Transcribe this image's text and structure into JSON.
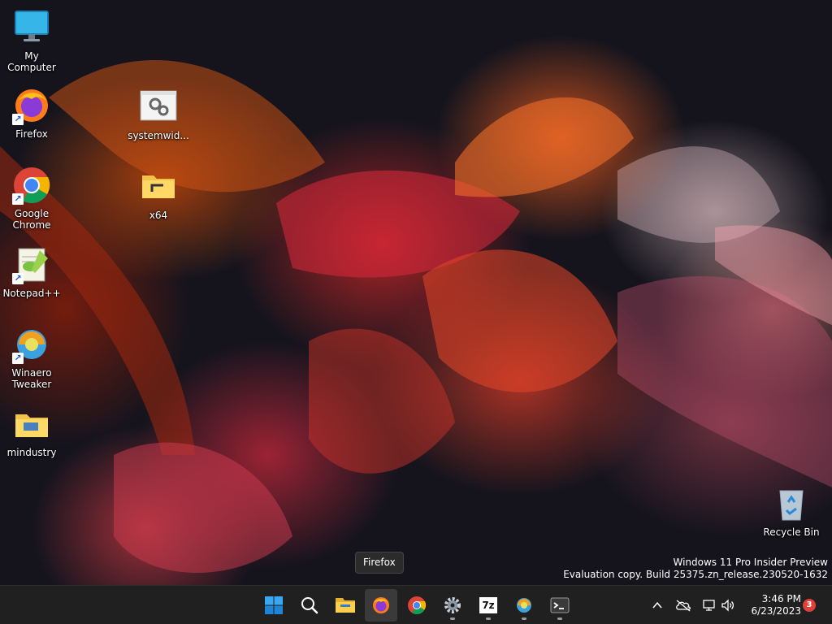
{
  "desktop": {
    "icons": [
      {
        "label": "My Computer"
      },
      {
        "label": "Firefox"
      },
      {
        "label": "Google Chrome"
      },
      {
        "label": "Notepad++"
      },
      {
        "label": "Winaero Tweaker"
      },
      {
        "label": "mindustry"
      },
      {
        "label": "systemwid..."
      },
      {
        "label": "x64"
      },
      {
        "label": "Recycle Bin"
      }
    ]
  },
  "tooltip": {
    "text": "Firefox"
  },
  "watermark": {
    "line1": "Windows 11 Pro Insider Preview",
    "line2": "Evaluation copy. Build 25375.zn_release.230520-1632"
  },
  "taskbar": {
    "apps": [
      {
        "name": "start",
        "icon": "windows-logo-icon"
      },
      {
        "name": "search",
        "icon": "search-icon"
      },
      {
        "name": "file-explorer",
        "icon": "folder-icon"
      },
      {
        "name": "firefox",
        "icon": "firefox-icon"
      },
      {
        "name": "chrome",
        "icon": "chrome-icon"
      },
      {
        "name": "settings",
        "icon": "gear-icon"
      },
      {
        "name": "7zip",
        "icon": "7zip-icon",
        "glyph": "7z"
      },
      {
        "name": "winaero-tweaker",
        "icon": "winaero-tweaker-icon"
      },
      {
        "name": "terminal",
        "icon": "terminal-icon"
      }
    ],
    "tray": {
      "clock_time": "3:46 PM",
      "clock_date": "6/23/2023",
      "notification_count": "3"
    }
  },
  "colors": {
    "taskbar_bg": "#202020",
    "accent_blue": "#0078d4",
    "badge_red": "#e0403a"
  }
}
